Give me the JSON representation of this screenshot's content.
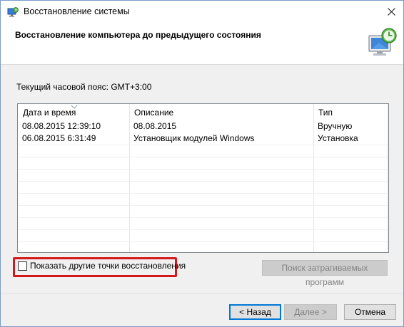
{
  "window": {
    "title": "Восстановление системы",
    "icon": "system-restore-icon"
  },
  "header": {
    "title": "Восстановление компьютера до предыдущего состояния",
    "art": "system-restore-clock-icon"
  },
  "timezone": "Текущий часовой пояс: GMT+3:00",
  "table": {
    "columns": [
      "Дата и время",
      "Описание",
      "Тип"
    ],
    "rows": [
      [
        "08.08.2015 12:39:10",
        "08.08.2015",
        "Вручную"
      ],
      [
        "06.08.2015 6:31:49",
        "Установщик модулей Windows",
        "Установка"
      ]
    ]
  },
  "show_more": {
    "label": "Показать другие точки восстановления",
    "checked": false
  },
  "scan_button": "Поиск затрагиваемых программ",
  "footer": {
    "back": "< Назад",
    "next": "Далее >",
    "cancel": "Отмена"
  },
  "colors": {
    "highlight": "#d4191c",
    "accent": "#0078d7"
  }
}
